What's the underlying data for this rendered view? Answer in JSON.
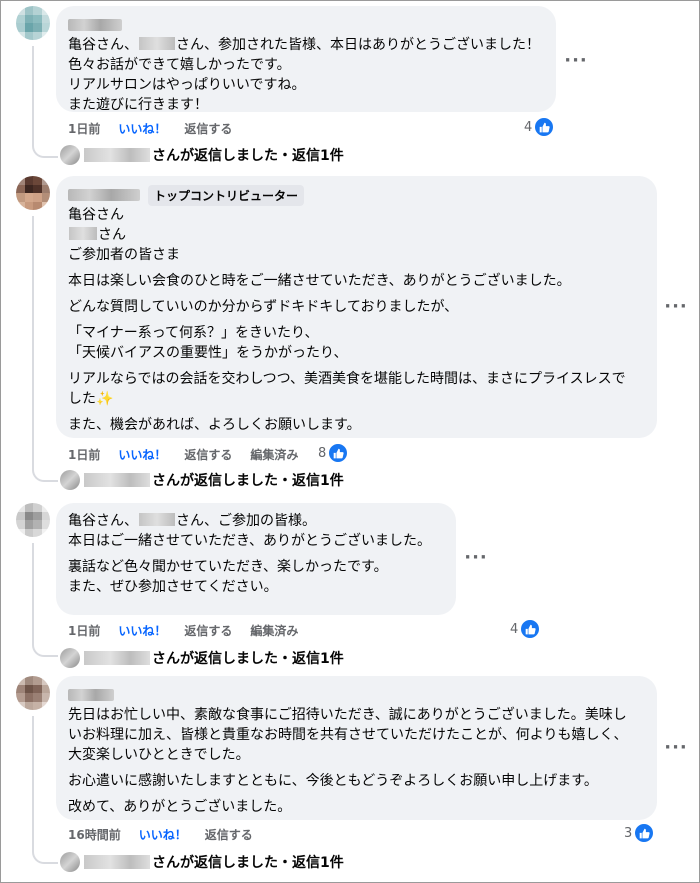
{
  "colors": {
    "like_blue": "#0866ff",
    "meta_gray": "#65676b",
    "bubble_bg": "#f0f2f5",
    "react_blue": "#1877f2"
  },
  "comments": [
    {
      "lines": [
        "亀谷さん、",
        "さん、参加された皆様、本日はありがとうございました！",
        "色々お話ができて嬉しかったです。",
        "リアルサロンはやっぱりいいですね。",
        "また遊びに行きます！"
      ],
      "actions": {
        "time": "1日前",
        "like": "いいね！",
        "reply": "返信する"
      },
      "reactions": "4",
      "reply_summary": "さんが返信しました・返信1件",
      "more": "···"
    },
    {
      "badge": "トップコントリビューター",
      "lines": [
        "亀谷さん",
        "さん",
        "ご参加者の皆さま",
        "本日は楽しい会食のひと時をご一緒させていただき、ありがとうございました。",
        "どんな質問していいのか分からずドキドキしておりましたが、",
        "「マイナー系って何系？」をきいたり、",
        "「天候バイアスの重要性」をうかがったり、",
        "リアルならではの会話を交わしつつ、美酒美食を堪能した時間は、まさにプライスレスで",
        "した",
        "また、機会があれば、よろしくお願いします。"
      ],
      "sparkle": "✨",
      "actions": {
        "time": "1日前",
        "like": "いいね！",
        "reply": "返信する",
        "edited": "編集済み"
      },
      "reactions": "8",
      "reply_summary": "さんが返信しました・返信1件",
      "more": "···"
    },
    {
      "lines": [
        "亀谷さん、",
        "さん、ご参加の皆様。",
        "本日はご一緒させていただき、ありがとうございました。",
        "裏話など色々聞かせていただき、楽しかったです。",
        "また、ぜひ参加させてください。"
      ],
      "actions": {
        "time": "1日前",
        "like": "いいね！",
        "reply": "返信する",
        "edited": "編集済み"
      },
      "reactions": "4",
      "reply_summary": "さんが返信しました・返信1件",
      "more": "···"
    },
    {
      "lines": [
        "先日はお忙しい中、素敵な食事にご招待いただき、誠にありがとうございました。美味し",
        "いお料理に加え、皆様と貴重なお時間を共有させていただけたことが、何よりも嬉しく、",
        "大変楽しいひとときでした。",
        "お心遣いに感謝いたしますとともに、今後ともどうぞよろしくお願い申し上げます。",
        "改めて、ありがとうございました。"
      ],
      "actions": {
        "time": "16時間前",
        "like": "いいね！",
        "reply": "返信する"
      },
      "reactions": "3",
      "reply_summary": "さんが返信しました・返信1件",
      "more": "···"
    }
  ]
}
